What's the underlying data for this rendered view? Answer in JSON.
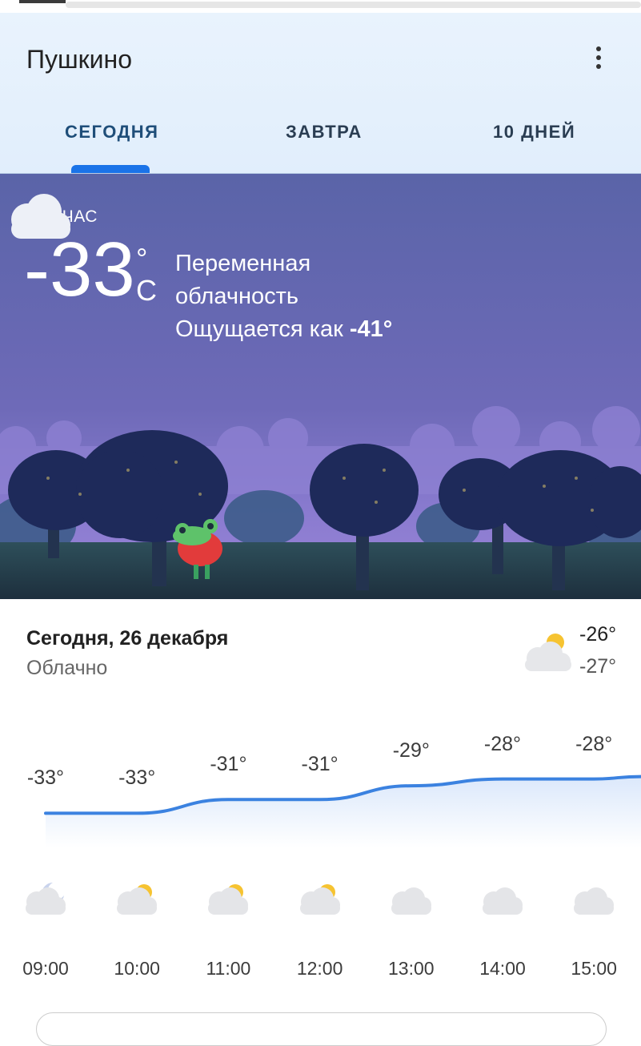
{
  "header": {
    "city": "Пушкино",
    "tabs": [
      {
        "label": "СЕГОДНЯ",
        "active": true
      },
      {
        "label": "ЗАВТРА",
        "active": false
      },
      {
        "label": "10 ДНЕЙ",
        "active": false
      }
    ],
    "menu_icon": "more-vert-icon"
  },
  "current": {
    "label": "СЕЙЧАС",
    "temperature": "-33",
    "degree": "°",
    "unit": "C",
    "condition_line1": "Переменная",
    "condition_line2": "облачность",
    "feels_prefix": "Ощущается как",
    "feels_value": "-41°",
    "icon": "night-partly-cloudy-icon"
  },
  "day": {
    "date": "Сегодня, 26 декабря",
    "condition": "Облачно",
    "high": "-26°",
    "low": "-27°",
    "icon": "partly-cloudy-day-icon"
  },
  "hourly": [
    {
      "time": "09:00",
      "temp": "-33°",
      "icon": "night-cloud-icon"
    },
    {
      "time": "10:00",
      "temp": "-33°",
      "icon": "sun-cloud-icon"
    },
    {
      "time": "11:00",
      "temp": "-31°",
      "icon": "sun-cloud-icon"
    },
    {
      "time": "12:00",
      "temp": "-31°",
      "icon": "sun-cloud-icon"
    },
    {
      "time": "13:00",
      "temp": "-29°",
      "icon": "cloud-icon"
    },
    {
      "time": "14:00",
      "temp": "-28°",
      "icon": "cloud-icon"
    },
    {
      "time": "15:00",
      "temp": "-28°",
      "icon": "cloud-icon"
    }
  ],
  "colors": {
    "accent": "#1a73e8",
    "graph_line": "#3b82e0",
    "sky": "#5b62a8"
  }
}
